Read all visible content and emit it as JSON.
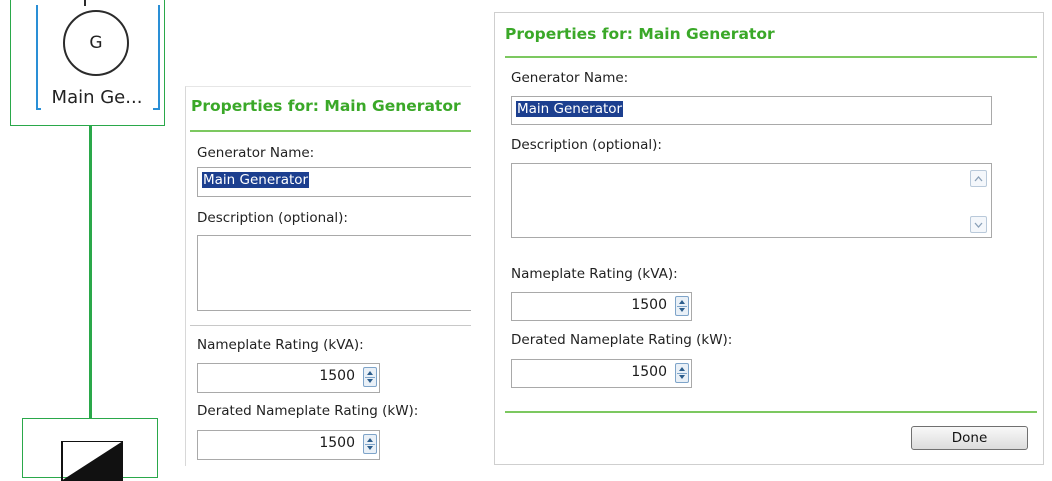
{
  "diagram": {
    "generator_symbol": "G",
    "generator_label": "Main Ge...",
    "line_color": "#2aa84a",
    "selection_color": "#2a8fd6"
  },
  "panel_left": {
    "title": "Properties for: Main Generator",
    "name_label": "Generator Name:",
    "name_value": "Main Generator",
    "description_label": "Description (optional):",
    "nameplate_label": "Nameplate Rating (kVA):",
    "nameplate_value": "1500",
    "derated_label": "Derated Nameplate Rating (kW):",
    "derated_value": "1500"
  },
  "panel_right": {
    "title": "Properties for: Main Generator",
    "name_label": "Generator Name:",
    "name_value": "Main Generator",
    "description_label": "Description (optional):",
    "nameplate_label": "Nameplate Rating (kVA):",
    "nameplate_value": "1500",
    "derated_label": "Derated Nameplate Rating (kW):",
    "derated_value": "1500",
    "done_label": "Done"
  },
  "colors": {
    "title_green": "#3aa828",
    "selection_blue": "#1c3f8f"
  }
}
